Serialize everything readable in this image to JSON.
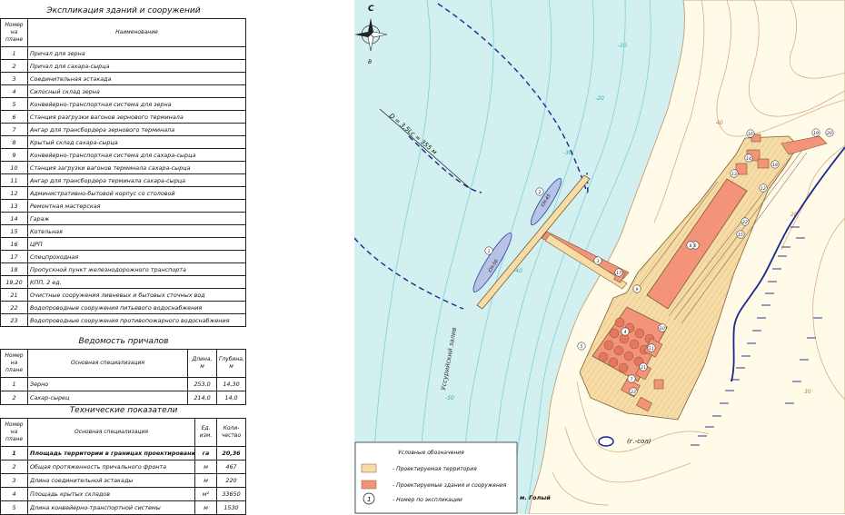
{
  "explication": {
    "title": "Экспликация зданий и сооружений",
    "headers": {
      "num": "Номер на плане",
      "name": "Наименование"
    },
    "rows": [
      {
        "num": "1",
        "name": "Причал для зерна"
      },
      {
        "num": "2",
        "name": "Причал для сахара-сырца"
      },
      {
        "num": "3",
        "name": "Соединительная эстакада"
      },
      {
        "num": "4",
        "name": "Силосный склад зерна"
      },
      {
        "num": "5",
        "name": "Конвейерно-транспортная система для зерна"
      },
      {
        "num": "6",
        "name": "Станция разгрузки вагонов зернового терминала"
      },
      {
        "num": "7",
        "name": "Ангар для трансбордера зернового терминала"
      },
      {
        "num": "8",
        "name": "Крытый склад сахара-сырца"
      },
      {
        "num": "9",
        "name": "Конвейерно-транспортная система для сахара-сырца"
      },
      {
        "num": "10",
        "name": "Станция загрузки вагонов терминала сахара-сырца"
      },
      {
        "num": "11",
        "name": "Ангар для трансбордера терминала сахара-сырца"
      },
      {
        "num": "12",
        "name": "Административно-бытовой корпус со столовой"
      },
      {
        "num": "13",
        "name": "Ремонтная мастерская"
      },
      {
        "num": "14",
        "name": "Гараж"
      },
      {
        "num": "15",
        "name": "Котельная"
      },
      {
        "num": "16",
        "name": "ЦРП"
      },
      {
        "num": "17",
        "name": "Спецпроходная"
      },
      {
        "num": "18",
        "name": "Пропускной пункт железнодорожного транспорта"
      },
      {
        "num": "19,20",
        "name": "КПП, 2 ед."
      },
      {
        "num": "21",
        "name": "Очистные сооружения ливневых и бытовых сточных вод"
      },
      {
        "num": "22",
        "name": "Водопроводные сооружения питьевого водоснабжения"
      },
      {
        "num": "23",
        "name": "Водопроводные сооружения противопожарного водоснабжения"
      }
    ]
  },
  "berths": {
    "title": "Ведомость причалов",
    "headers": {
      "num": "Номер на плане",
      "spec": "Основная специализация",
      "length": "Длина, м",
      "depth": "Глубина, м"
    },
    "rows": [
      {
        "num": "1",
        "spec": "Зерно",
        "length": "253,0",
        "depth": "14,30"
      },
      {
        "num": "2",
        "spec": "Сахар-сырец",
        "length": "214,0",
        "depth": "14,0"
      }
    ]
  },
  "indicators": {
    "title": "Технические показатели",
    "headers": {
      "num": "Номер на плане",
      "spec": "Основная специализация",
      "unit": "Ед. изм.",
      "qty": "Коли-чество"
    },
    "rows": [
      {
        "num": "1",
        "spec": "Площадь территории в границах проектирования",
        "unit": "га",
        "qty": "20,36",
        "bold": true
      },
      {
        "num": "2",
        "spec": "Общая протяженность причального фронта",
        "unit": "м",
        "qty": "467"
      },
      {
        "num": "3",
        "spec": "Длина соединительной эстакады",
        "unit": "м",
        "qty": "220"
      },
      {
        "num": "4",
        "spec": "Площадь крытых складов",
        "unit": "м²",
        "qty": "33650"
      },
      {
        "num": "5",
        "spec": "Длина конвейерно-транспортной системы",
        "unit": "м",
        "qty": "1530"
      }
    ]
  },
  "map": {
    "compass": {
      "north": "С",
      "south": "В"
    },
    "circle_label": "D = 3,5Lс = 355 м",
    "bay_label": "Уссурийский залив",
    "lake_label": "(г.-сол)",
    "cape_label": "м. Голый",
    "ship1": "СН-50",
    "ship2": "СН-45",
    "contours": [
      "-10",
      "-20",
      "-30",
      "-40",
      "-50",
      "40",
      "20",
      "30"
    ],
    "plan_numbers": [
      "1",
      "2",
      "3",
      "4",
      "5",
      "6",
      "7",
      "8",
      "9",
      "10",
      "11",
      "12",
      "13",
      "14",
      "15",
      "16",
      "17",
      "18",
      "19",
      "20",
      "21",
      "22",
      "23"
    ],
    "legend": {
      "title": "Условные обозначения",
      "items": [
        {
          "color": "#f7dca5",
          "label": "- Проектируемая территория"
        },
        {
          "color": "#f2937a",
          "label": "- Проектируемые здания и сооружения"
        },
        {
          "symbol": "1",
          "label": "- Номер по экспликации"
        }
      ]
    },
    "colors": {
      "sea": "#d3f0f1",
      "land": "#fffbe8",
      "territory": "#f7dca5",
      "building": "#f2937a",
      "contour_sea": "#7fd0d3",
      "contour_land": "#d8ad86",
      "navy": "#1a2a8c"
    }
  }
}
